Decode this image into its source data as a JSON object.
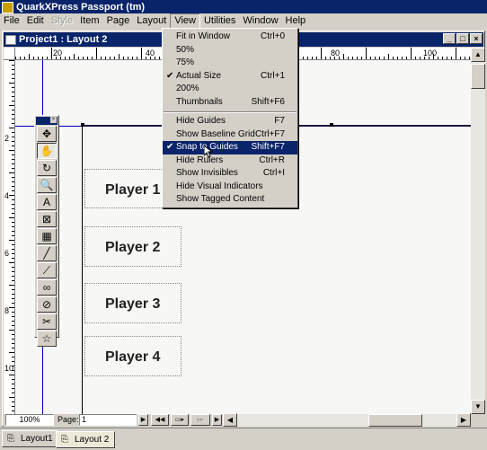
{
  "app_title": "QuarkXPress Passport (tm)",
  "menubar": [
    {
      "label": "File",
      "disabled": false
    },
    {
      "label": "Edit",
      "disabled": false
    },
    {
      "label": "Style",
      "disabled": true
    },
    {
      "label": "Item",
      "disabled": false
    },
    {
      "label": "Page",
      "disabled": false
    },
    {
      "label": "Layout",
      "disabled": false
    },
    {
      "label": "View",
      "disabled": false,
      "active": true
    },
    {
      "label": "Utilities",
      "disabled": false
    },
    {
      "label": "Window",
      "disabled": false
    },
    {
      "label": "Help",
      "disabled": false
    }
  ],
  "document": {
    "title": "Project1 : Layout 2",
    "ruler_top_labels": [
      "20",
      "40",
      "60",
      "80",
      "100"
    ],
    "ruler_left_labels": [
      "2",
      "4",
      "6",
      "8",
      "10",
      "12"
    ],
    "boxes": [
      "Player 1",
      "Player 2",
      "Player 3",
      "Player 4"
    ],
    "zoom": "100%",
    "page_label": "Page:",
    "page_value": "1"
  },
  "view_menu": {
    "group1": [
      {
        "label": "Fit in Window",
        "shortcut": "Ctrl+0",
        "checked": false
      },
      {
        "label": "50%",
        "shortcut": "",
        "checked": false
      },
      {
        "label": "75%",
        "shortcut": "",
        "checked": false
      },
      {
        "label": "Actual Size",
        "shortcut": "Ctrl+1",
        "checked": true
      },
      {
        "label": "200%",
        "shortcut": "",
        "checked": false
      },
      {
        "label": "Thumbnails",
        "shortcut": "Shift+F6",
        "checked": false
      }
    ],
    "group2": [
      {
        "label": "Hide Guides",
        "shortcut": "F7",
        "checked": false
      },
      {
        "label": "Show Baseline Grid",
        "shortcut": "Ctrl+F7",
        "checked": false
      },
      {
        "label": "Snap to Guides",
        "shortcut": "Shift+F7",
        "checked": true,
        "selected": true
      },
      {
        "label": "Hide Rulers",
        "shortcut": "Ctrl+R",
        "checked": false
      },
      {
        "label": "Show Invisibles",
        "shortcut": "Ctrl+I",
        "checked": false
      },
      {
        "label": "Hide Visual Indicators",
        "shortcut": "",
        "checked": false
      },
      {
        "label": "Show Tagged Content",
        "shortcut": "",
        "checked": false
      }
    ]
  },
  "tools": [
    "item-tool",
    "content-tool",
    "rotation-tool",
    "zoom-tool",
    "text-box-tool",
    "picture-box-tool",
    "table-tool",
    "line-tool",
    "text-path-tool",
    "linking-tool",
    "unlinking-tool",
    "scissors-tool",
    "starburst-tool"
  ],
  "layout_tabs": [
    {
      "label": "Layout1",
      "active": false
    },
    {
      "label": "Layout 2",
      "active": true
    }
  ]
}
